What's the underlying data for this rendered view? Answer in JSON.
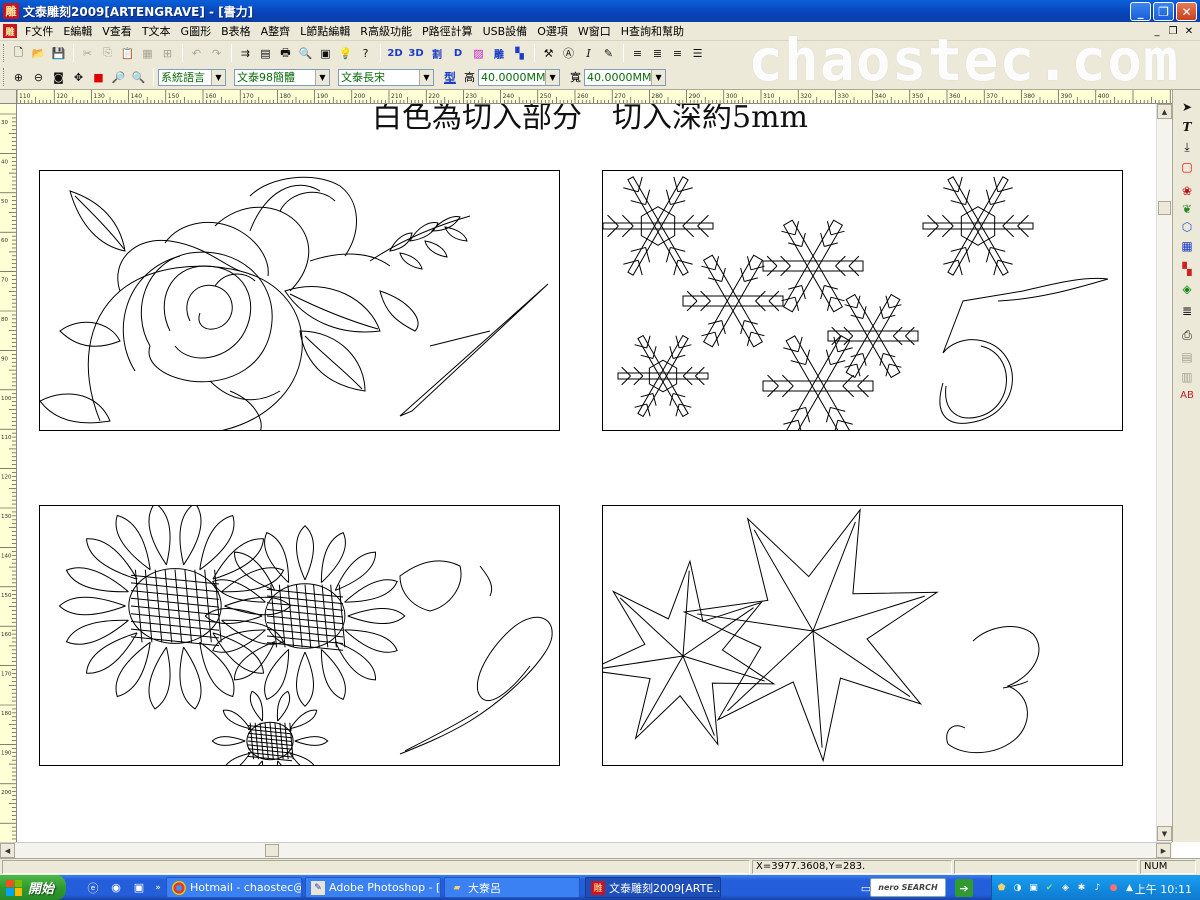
{
  "window": {
    "title": "文泰雕刻2009[ARTENGRAVE] - [書力]",
    "app_icon_text": "雕",
    "minimize": "_",
    "maximize": "❐",
    "close": "✕"
  },
  "menu": {
    "items": [
      "F文件",
      "E編輯",
      "V查看",
      "T文本",
      "G圖形",
      "B表格",
      "A整齊",
      "L節點編輯",
      "R高級功能",
      "P路徑計算",
      "USB設備",
      "O選項",
      "W窗口",
      "H查詢和幫助"
    ],
    "mdi_min": "_",
    "mdi_restore": "❐",
    "mdi_close": "✕"
  },
  "toolbar1": {
    "text_buttons": [
      "2D",
      "3D",
      "割",
      "D",
      "雕"
    ]
  },
  "toolbar2": {
    "language": "系統語言",
    "font1": "文泰98簡體",
    "font2": "文泰長宋",
    "type_label": "型",
    "height_label": "高",
    "height_value": "40.0000MM",
    "width_label": "寬",
    "width_value": "40.0000MM"
  },
  "watermark": "chaostec.com",
  "ruler": {
    "h_labels": [
      "110",
      "120",
      "130",
      "140",
      "150",
      "160",
      "170",
      "180",
      "190",
      "200",
      "210",
      "220",
      "230",
      "240",
      "250",
      "260",
      "270",
      "280",
      "290",
      "300",
      "310",
      "320",
      "330",
      "340",
      "350",
      "360",
      "370",
      "380",
      "390",
      "400"
    ],
    "v_labels": [
      "30",
      "40",
      "50",
      "60",
      "70",
      "80",
      "90",
      "100",
      "110",
      "120",
      "130",
      "140",
      "150",
      "160",
      "170",
      "180",
      "190",
      "200"
    ]
  },
  "canvas": {
    "heading": "白色為切入部分　切入深約5mm",
    "numbers": [
      "1",
      "5",
      "9",
      "3"
    ]
  },
  "status": {
    "coords": "X=3977.3608,Y=283.",
    "num": "NUM"
  },
  "taskbar": {
    "start": "開始",
    "tasks": [
      {
        "label": "Hotmail - chaostec@h...",
        "icon": "chrome-icon"
      },
      {
        "label": "Adobe Photoshop - [la...",
        "icon": "photoshop-icon"
      },
      {
        "label": "大寮呂",
        "icon": "folder-icon"
      },
      {
        "label": "文泰雕刻2009[ARTE...",
        "icon": "engrave-icon"
      }
    ],
    "nero": "nero SEARCH",
    "clock": "上午 10:11"
  },
  "colors": {
    "titlebar": "#0843b8",
    "chrome": "#ece9d8",
    "ruler": "#ffffd6",
    "taskbar": "#245edb",
    "start": "#2f9a2e"
  }
}
